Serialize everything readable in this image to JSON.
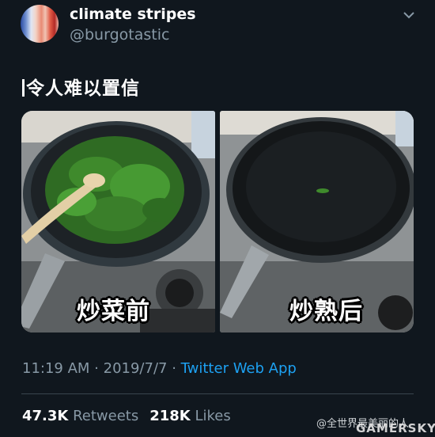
{
  "user": {
    "name": "climate stripes",
    "handle": "@burgotastic"
  },
  "tweet": {
    "text": "令人难以置信"
  },
  "photos": [
    {
      "caption": "炒菜前"
    },
    {
      "caption": "炒熟后"
    }
  ],
  "meta": {
    "time": "11:19 AM",
    "sep": " · ",
    "date": "2019/7/7",
    "app": "Twitter Web App"
  },
  "stats": {
    "retweets_count": "47.3K",
    "retweets_label": "Retweets",
    "likes_count": "218K",
    "likes_label": "Likes"
  },
  "watermark": {
    "text": "@全世界最美丽的人",
    "brand": "GAMERSKY"
  },
  "colors": {
    "background": "#10171e",
    "accent": "#1da1f2",
    "muted": "#8899a6"
  },
  "icons": {
    "caret": "chevron-down-icon"
  }
}
